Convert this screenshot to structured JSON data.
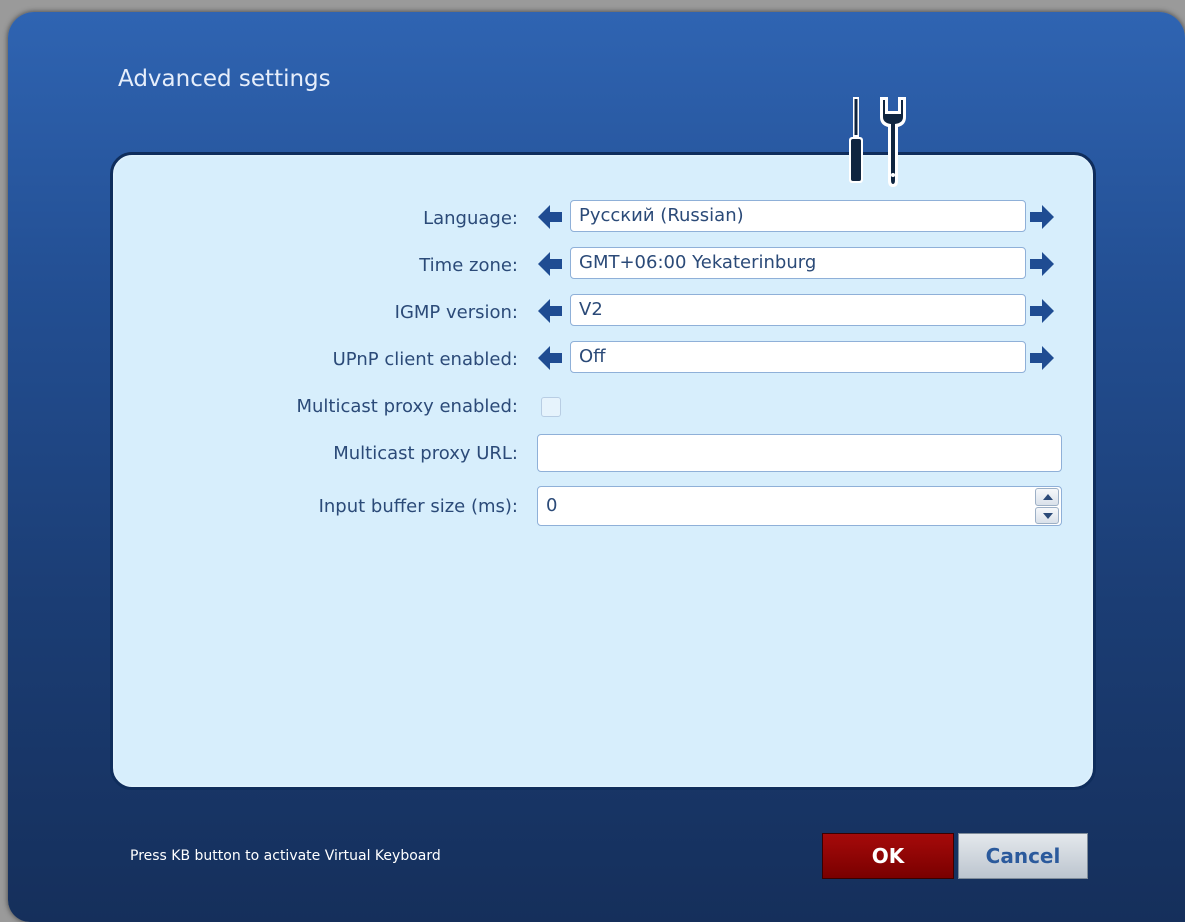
{
  "dialog": {
    "title": "Advanced settings"
  },
  "settings": {
    "language": {
      "label": "Language:",
      "value": "Русский (Russian)"
    },
    "time_zone": {
      "label": "Time zone:",
      "value": "GMT+06:00 Yekaterinburg"
    },
    "igmp_version": {
      "label": "IGMP version:",
      "value": "V2"
    },
    "upnp_client": {
      "label": "UPnP client enabled:",
      "value": "Off"
    },
    "multicast_proxy_enabled": {
      "label": "Multicast proxy enabled:",
      "checked": false
    },
    "multicast_proxy_url": {
      "label": "Multicast proxy URL:",
      "value": ""
    },
    "input_buffer_size": {
      "label": "Input buffer size (ms):",
      "value": "0"
    }
  },
  "footer": {
    "hint": "Press KB button to activate Virtual Keyboard",
    "ok_label": "OK",
    "cancel_label": "Cancel"
  },
  "colors": {
    "arrow": "#1f4c92",
    "ok_button": "#8b0000",
    "panel": "#d7eefc"
  },
  "icons": {
    "tools": "screwdriver-wrench-icon",
    "prev": "arrow-left-icon",
    "next": "arrow-right-icon"
  }
}
